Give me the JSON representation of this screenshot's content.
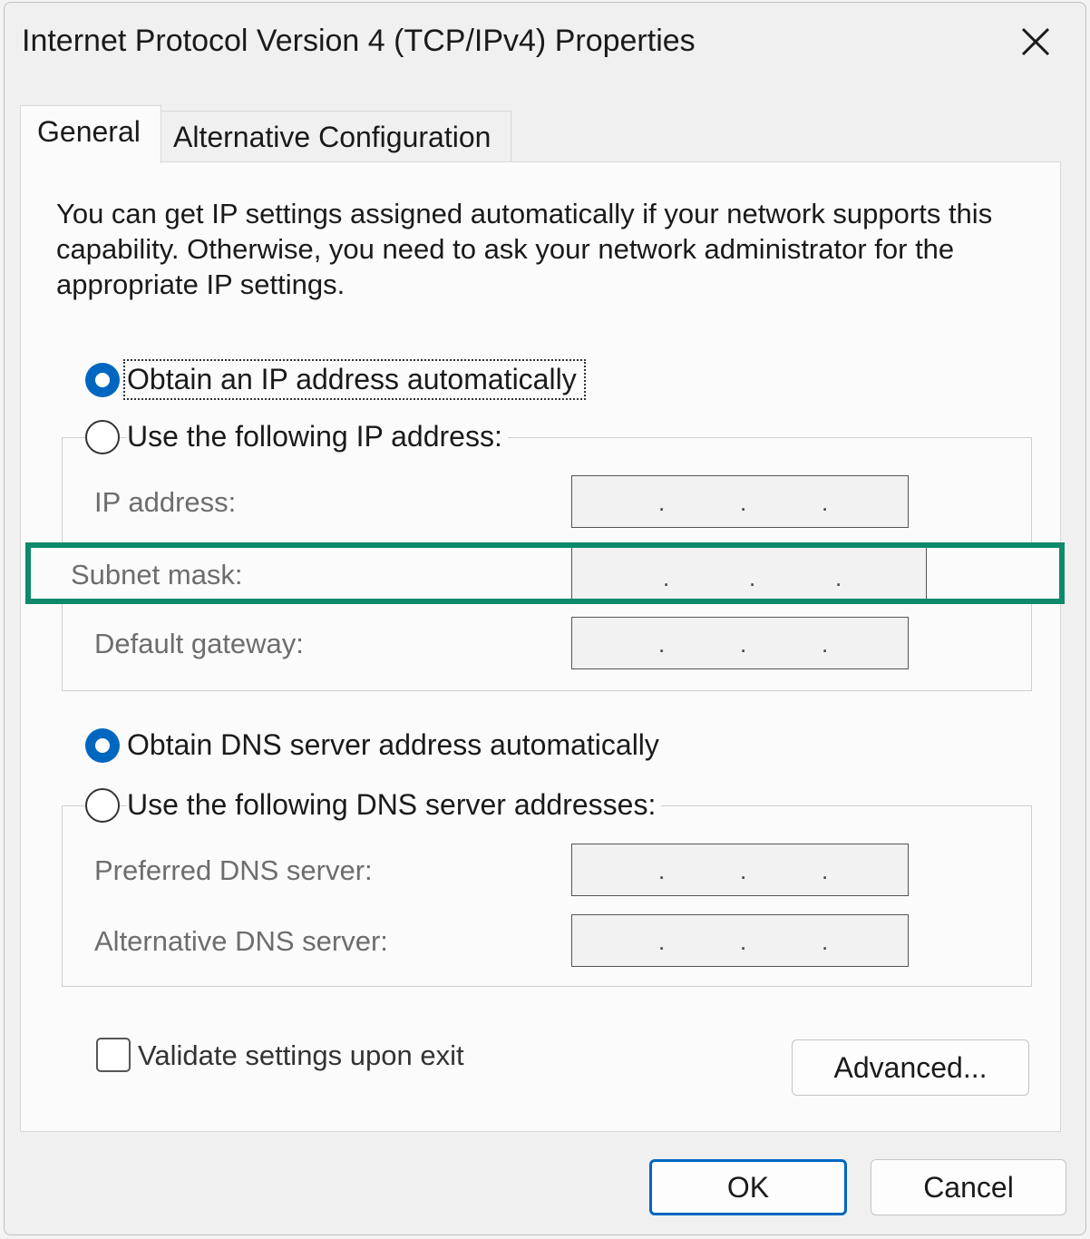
{
  "window": {
    "title": "Internet Protocol Version 4 (TCP/IPv4) Properties"
  },
  "tabs": [
    {
      "label": "General",
      "selected": true
    },
    {
      "label": "Alternative Configuration",
      "selected": false
    }
  ],
  "intro_text": "You can get IP settings assigned automatically if your network supports this capability. Otherwise, you need to ask your network administrator for the appropriate IP settings.",
  "ip_section": {
    "auto_label": "Obtain an IP address automatically",
    "auto_selected": true,
    "manual_label": "Use the following IP address:",
    "manual_selected": false,
    "fields": [
      {
        "label": "IP address:",
        "value": ". . ."
      },
      {
        "label": "Subnet mask:",
        "value": ". . ."
      },
      {
        "label": "Default gateway:",
        "value": ". . ."
      }
    ]
  },
  "dns_section": {
    "auto_label": "Obtain DNS server address automatically",
    "auto_selected": true,
    "manual_label": "Use the following DNS server addresses:",
    "manual_selected": false,
    "fields": [
      {
        "label": "Preferred DNS server:",
        "value": ". . ."
      },
      {
        "label": "Alternative DNS server:",
        "value": ". . ."
      }
    ]
  },
  "validate": {
    "label": "Validate settings upon exit",
    "checked": false
  },
  "buttons": {
    "advanced": "Advanced...",
    "ok": "OK",
    "cancel": "Cancel"
  },
  "colors": {
    "accent": "#0067c0",
    "highlight": "#0e8a6a"
  },
  "icons": {
    "close": "close-icon"
  }
}
